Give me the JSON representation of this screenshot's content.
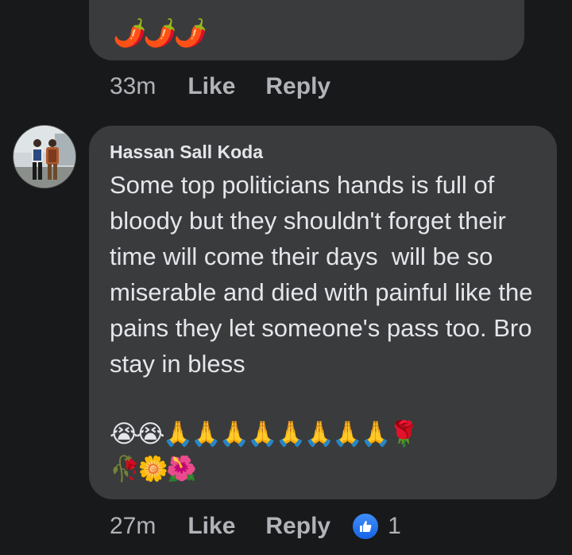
{
  "previous_comment": {
    "emojis": "🌶️🌶️🌶️",
    "time": "33m",
    "like_label": "Like",
    "reply_label": "Reply"
  },
  "comment": {
    "author": "Hassan Sall Koda",
    "text": "Some top politicians hands is full of bloody but they shouldn't forget their time will come their days  will be so miserable and died with painful like the pains they let someone's pass too. Bro stay in bless",
    "emojis_line1": "😭😭🙏🙏🙏🙏🙏🙏🙏🙏🌹",
    "emojis_line2": "🥀🌼🌺",
    "time": "27m",
    "like_label": "Like",
    "reply_label": "Reply",
    "reaction_icon": "thumbs-up-icon",
    "reaction_count": "1"
  },
  "colors": {
    "background": "#18191a",
    "bubble": "#3a3b3c",
    "text": "#e4e6eb",
    "secondary_text": "#b0b3b8",
    "like_blue": "#1877f2"
  }
}
